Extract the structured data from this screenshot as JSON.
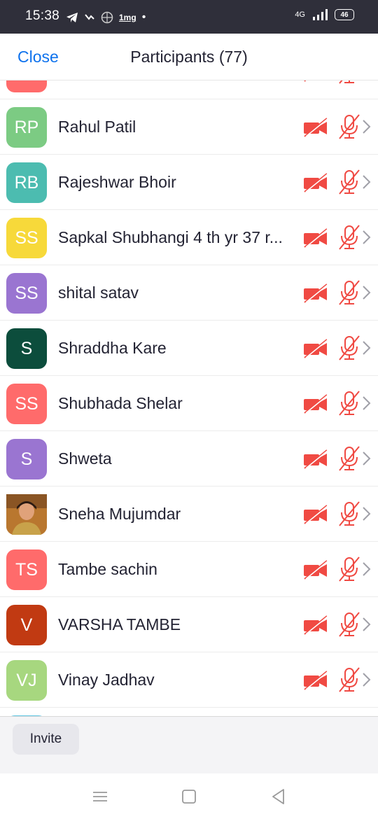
{
  "status_bar": {
    "time": "15:38",
    "network_label": "4G",
    "battery": "46",
    "notif_label": "1mg"
  },
  "header": {
    "close_label": "Close",
    "title": "Participants (77)"
  },
  "participants": [
    {
      "name": "",
      "initials": "",
      "color": "#ff6b6b"
    },
    {
      "name": "Rahul Patil",
      "initials": "RP",
      "color": "#7ccb83"
    },
    {
      "name": "Rajeshwar Bhoir",
      "initials": "RB",
      "color": "#4cbcb0"
    },
    {
      "name": "Sapkal Shubhangi 4 th yr 37 r...",
      "initials": "SS",
      "color": "#f7d93a"
    },
    {
      "name": "shital satav",
      "initials": "SS",
      "color": "#9a75d1"
    },
    {
      "name": "Shraddha Kare",
      "initials": "S",
      "color": "#0c4d3c"
    },
    {
      "name": "Shubhada Shelar",
      "initials": "SS",
      "color": "#ff6b6b"
    },
    {
      "name": "Shweta",
      "initials": "S",
      "color": "#9a75d1"
    },
    {
      "name": "Sneha Mujumdar",
      "initials": "",
      "color": "#b9772f",
      "photo": true
    },
    {
      "name": "Tambe sachin",
      "initials": "TS",
      "color": "#ff6b6b"
    },
    {
      "name": "VARSHA TAMBE",
      "initials": "V",
      "color": "#c13a12"
    },
    {
      "name": "Vinay Jadhav",
      "initials": "VJ",
      "color": "#a7d77f"
    },
    {
      "name": "",
      "initials": "",
      "color": "#5fc6e3"
    }
  ],
  "icons": {
    "video": "video-off-icon",
    "mic": "mic-muted-icon",
    "chevron": "chevron-right-icon",
    "muted_color": "#f04a43"
  },
  "bottom": {
    "invite_label": "Invite"
  }
}
